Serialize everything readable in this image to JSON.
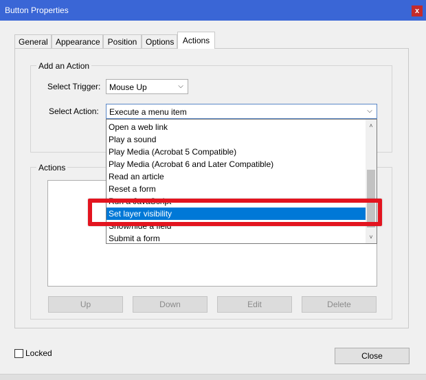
{
  "window": {
    "title": "Button Properties",
    "close_glyph": "x"
  },
  "tabs": [
    {
      "label": "General",
      "active": false
    },
    {
      "label": "Appearance",
      "active": false
    },
    {
      "label": "Position",
      "active": false
    },
    {
      "label": "Options",
      "active": false
    },
    {
      "label": "Actions",
      "active": true
    }
  ],
  "add_action": {
    "group_label": "Add an Action",
    "trigger_label": "Select Trigger:",
    "trigger_value": "Mouse Up",
    "action_label": "Select Action:",
    "action_value": "Execute a menu item"
  },
  "dropdown": {
    "items": [
      "Open a web link",
      "Play a sound",
      "Play Media (Acrobat 5 Compatible)",
      "Play Media (Acrobat 6 and Later Compatible)",
      "Read an article",
      "Reset a form",
      "Run a JavaScript",
      "Set layer visibility",
      "Show/hide a field",
      "Submit a form"
    ],
    "selected": "Set layer visibility"
  },
  "actions": {
    "group_label": "Actions",
    "buttons": {
      "up": "Up",
      "down": "Down",
      "edit": "Edit",
      "delete": "Delete"
    }
  },
  "footer": {
    "locked_label": "Locked",
    "close_label": "Close"
  },
  "colors": {
    "titlebar": "#3a66d6",
    "selection": "#0078d7",
    "highlight": "#e3141f"
  },
  "icons": {
    "chevron": "chevron-down-icon",
    "scroll_up": "chevron-up-icon"
  }
}
